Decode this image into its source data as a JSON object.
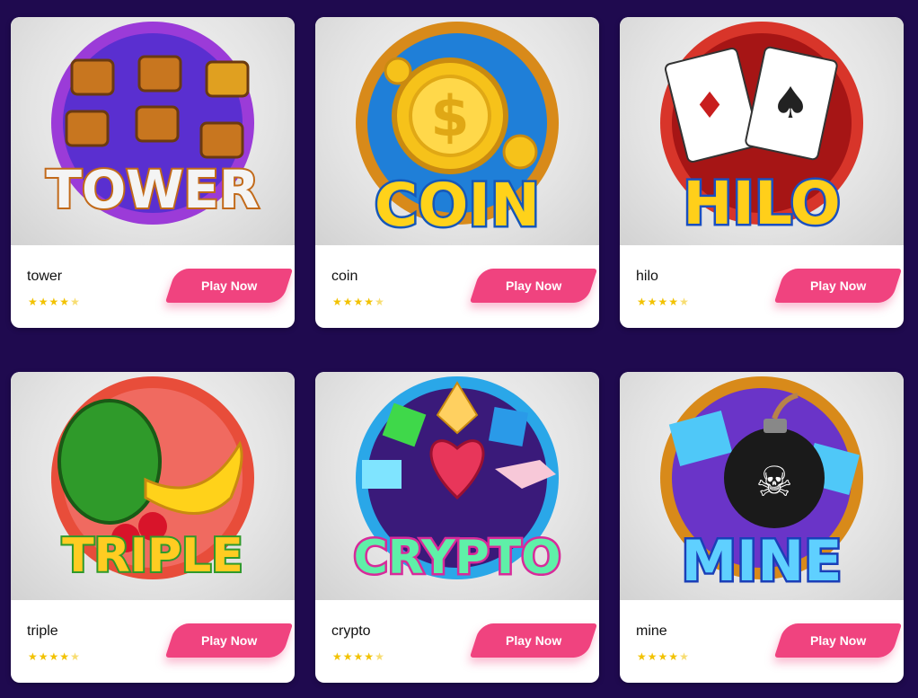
{
  "games": [
    {
      "name": "tower",
      "logo": "TOWER",
      "play_label": "Play Now",
      "rating": 4.5,
      "art": "treasure-chests",
      "colors": {
        "ring": "#9b3bd8",
        "inner": "#5a2fd0",
        "text": "#f4f4f4",
        "stroke": "#c26a1a"
      }
    },
    {
      "name": "coin",
      "logo": "COIN",
      "play_label": "Play Now",
      "rating": 4.5,
      "art": "gold-coin",
      "colors": {
        "ring": "#d88a1a",
        "inner": "#1f7fd8",
        "text": "#ffd21a",
        "stroke": "#1657b8"
      }
    },
    {
      "name": "hilo",
      "logo": "HILO",
      "play_label": "Play Now",
      "rating": 4.5,
      "art": "playing-cards",
      "colors": {
        "ring": "#d8352a",
        "inner": "#a61515",
        "text": "#ffcf1a",
        "stroke": "#1a4fc0"
      }
    },
    {
      "name": "triple",
      "logo": "TRIPLE",
      "play_label": "Play Now",
      "rating": 4.5,
      "art": "fruits",
      "colors": {
        "ring": "#e84d3a",
        "inner": "#f06a60",
        "text": "#ffcc22",
        "stroke": "#2f9a2a"
      }
    },
    {
      "name": "crypto",
      "logo": "CRYPTO",
      "play_label": "Play Now",
      "rating": 4.5,
      "art": "gems",
      "colors": {
        "ring": "#2aa7e8",
        "inner": "#3a1a7a",
        "text": "#5ff0a8",
        "stroke": "#d82a9a"
      }
    },
    {
      "name": "mine",
      "logo": "MINE",
      "play_label": "Play Now",
      "rating": 4.5,
      "art": "bomb",
      "colors": {
        "ring": "#d88a1a",
        "inner": "#6a34c8",
        "text": "#5fd0ff",
        "stroke": "#1a3fb8"
      }
    }
  ]
}
